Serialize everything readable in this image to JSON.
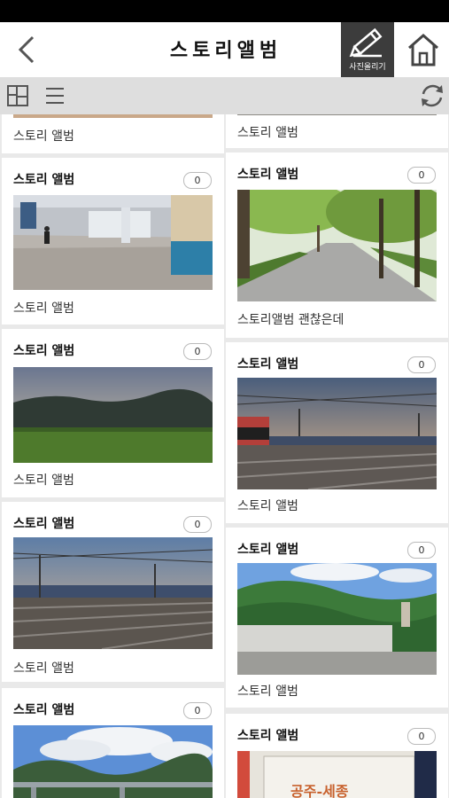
{
  "header": {
    "title": "스토리앨범",
    "upload_label": "사진올리기"
  },
  "cards_left": [
    {
      "caption": "스토리 앨범"
    },
    {
      "title": "스토리 앨범",
      "count": "0",
      "caption": "스토리 앨범"
    },
    {
      "title": "스토리 앨범",
      "count": "0",
      "caption": "스토리 앨범"
    },
    {
      "title": "스토리 앨범",
      "count": "0",
      "caption": "스토리 앨범"
    },
    {
      "title": "스토리 앨범",
      "count": "0"
    }
  ],
  "cards_right": [
    {
      "caption": "스토리 앨범"
    },
    {
      "title": "스토리 앨범",
      "count": "0",
      "caption": "스토리앨범 괜찮은데"
    },
    {
      "title": "스토리 앨범",
      "count": "0",
      "caption": "스토리 앨범"
    },
    {
      "title": "스토리 앨범",
      "count": "0",
      "caption": "스토리 앨범"
    },
    {
      "title": "스토리 앨범",
      "count": "0"
    }
  ],
  "photo_banner_text": "공주-세종"
}
